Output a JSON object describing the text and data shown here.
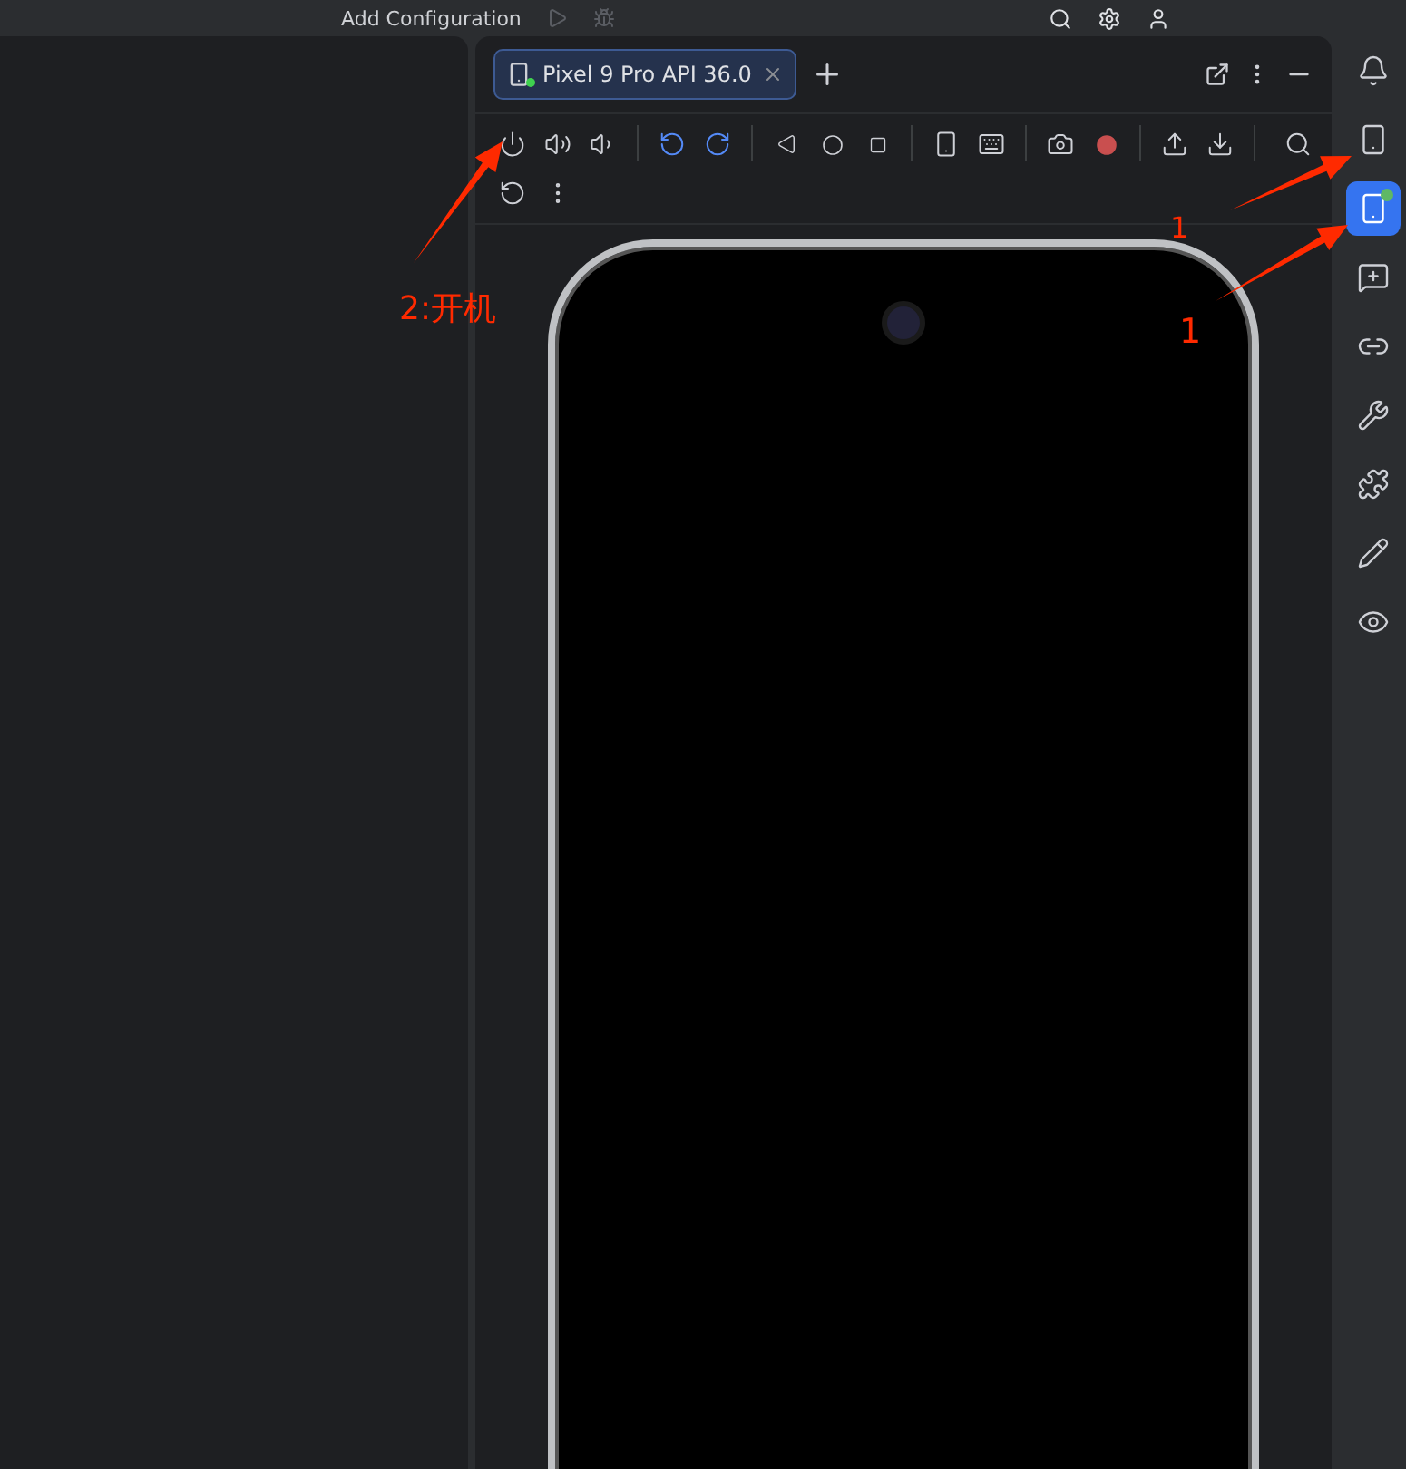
{
  "top_bar": {
    "run_configuration": "Add Configuration"
  },
  "emulator": {
    "tabs": [
      {
        "label": "Pixel 9 Pro API 36.0",
        "selected": true,
        "online": true
      }
    ],
    "device": {
      "powered": false
    }
  },
  "tool_strip": [
    {
      "kind": "notifications",
      "selected": false,
      "badge": false
    },
    {
      "kind": "device-manager",
      "selected": false,
      "badge": false
    },
    {
      "kind": "running-devices",
      "selected": true,
      "badge": true
    },
    {
      "kind": "gemini",
      "selected": false,
      "badge": false
    },
    {
      "kind": "link",
      "selected": false,
      "badge": false
    },
    {
      "kind": "tools",
      "selected": false,
      "badge": false
    },
    {
      "kind": "plugin",
      "selected": false,
      "badge": false
    },
    {
      "kind": "edit",
      "selected": false,
      "badge": false
    },
    {
      "kind": "preview",
      "selected": false,
      "badge": false
    }
  ],
  "annotations": [
    {
      "text": "2:开机"
    },
    {
      "text": "1"
    },
    {
      "text": "1"
    }
  ]
}
